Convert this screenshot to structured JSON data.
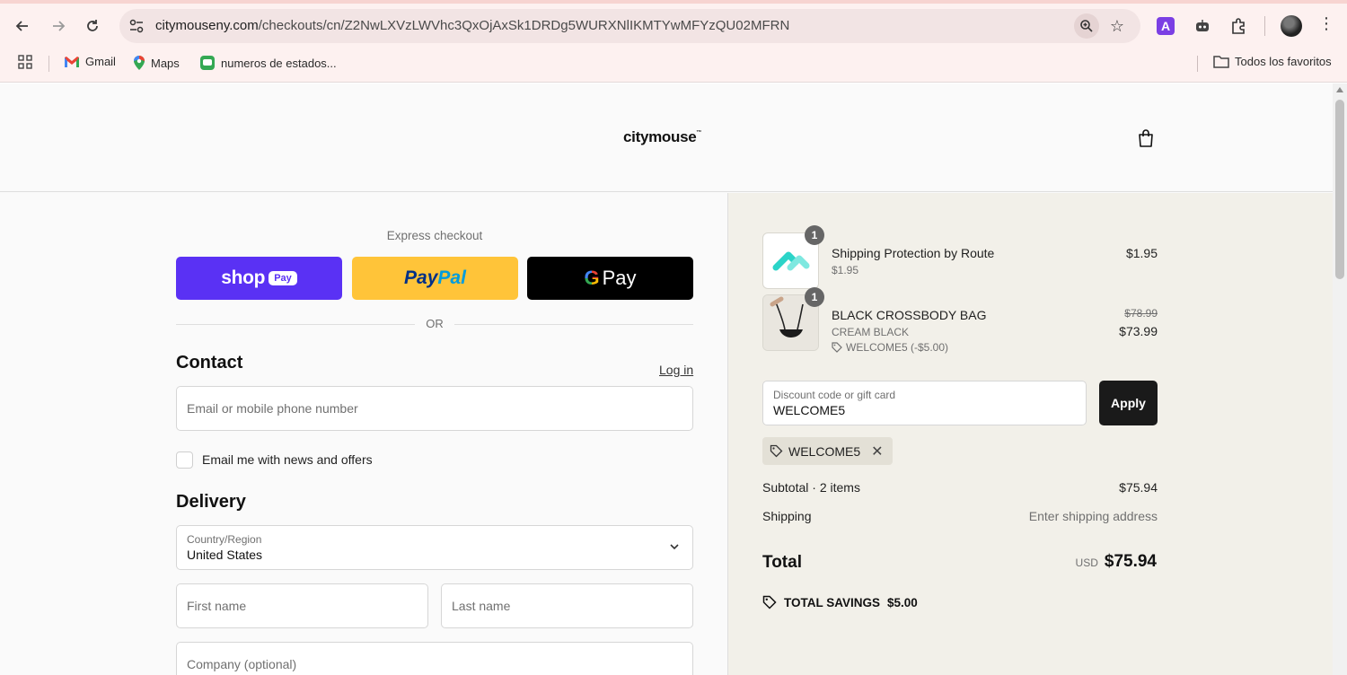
{
  "browser": {
    "url_host": "citymouseny.com",
    "url_path": "/checkouts/cn/Z2NwLXVzLWVhc3QxOjAxSk1DRDg5WURXNlIKMTYwMFYzQU02MFRN",
    "bookmarks": [
      {
        "label": "Gmail",
        "icon": "gmail-icon"
      },
      {
        "label": "Maps",
        "icon": "maps-icon"
      },
      {
        "label": "numeros de estados...",
        "icon": "chat-icon"
      }
    ],
    "all_bookmarks_label": "Todos los favoritos"
  },
  "header": {
    "logo": "citymouse",
    "logo_mark": "™"
  },
  "express": {
    "label": "Express checkout",
    "shop_word": "shop",
    "shop_pay": "Pay",
    "paypal_a": "Pay",
    "paypal_b": "Pal",
    "gpay_g": "G",
    "gpay_word": "Pay",
    "or": "OR"
  },
  "contact": {
    "title": "Contact",
    "login": "Log in",
    "email_placeholder": "Email or mobile phone number",
    "news_label": "Email me with news and offers"
  },
  "delivery": {
    "title": "Delivery",
    "country_label": "Country/Region",
    "country_value": "United States",
    "first_name_placeholder": "First name",
    "last_name_placeholder": "Last name",
    "company_placeholder": "Company (optional)"
  },
  "cart": {
    "items": [
      {
        "qty": "1",
        "name": "Shipping Protection by Route",
        "sub": "$1.95",
        "price": "$1.95"
      },
      {
        "qty": "1",
        "name": "BLACK CROSSBODY BAG",
        "sub": "CREAM BLACK",
        "discount": "WELCOME5 (-$5.00)",
        "old_price": "$78.99",
        "price": "$73.99"
      }
    ],
    "discount_label": "Discount code or gift card",
    "discount_value": "WELCOME5",
    "apply": "Apply",
    "applied_code": "WELCOME5",
    "subtotal_label": "Subtotal · 2 items",
    "subtotal_value": "$75.94",
    "shipping_label": "Shipping",
    "shipping_value": "Enter shipping address",
    "total_label": "Total",
    "currency": "USD",
    "total_value": "$75.94",
    "savings_label": "TOTAL SAVINGS",
    "savings_value": "$5.00"
  },
  "colors": {
    "shop_purple": "#5a31f4",
    "paypal_yellow": "#ffc439",
    "summary_bg": "#f2f0e9"
  }
}
